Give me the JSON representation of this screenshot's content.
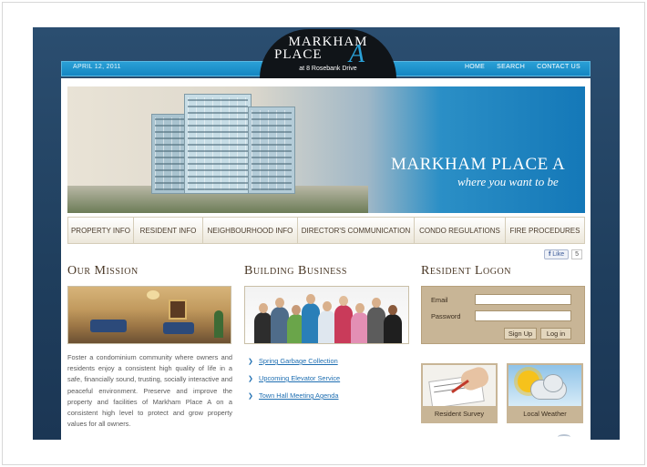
{
  "header": {
    "date": "APRIL 12, 2011",
    "nav": [
      "HOME",
      "SEARCH",
      "CONTACT US"
    ],
    "logo": {
      "line1": "MARKHAM",
      "line2": "PLACE",
      "letter": "A",
      "address": "at 8 Rosebank Drive"
    }
  },
  "hero": {
    "title": "MARKHAM PLACE A",
    "tagline": "where you want to be"
  },
  "mainnav": [
    "PROPERTY INFO",
    "RESIDENT INFO",
    "NEIGHBOURHOOD INFO",
    "DIRECTOR'S COMMUNICATION",
    "CONDO REGULATIONS",
    "FIRE PROCEDURES"
  ],
  "facebook": {
    "like_label": "Like",
    "count": "5"
  },
  "mission": {
    "title": "Our Mission",
    "text": "Foster a condominium community where owners and residents enjoy a consistent high quality of life in a safe, financially sound, trusting, socially interactive and peaceful environment. Preserve and improve the property and facilities of Markham Place A on a consistent high level to protect and grow property values for all owners."
  },
  "business": {
    "title": "Building Business",
    "links": [
      "Spring Garbage Collection",
      "Upcoming Elevator Service",
      "Town Hall Meeting Agenda"
    ]
  },
  "logon": {
    "title": "Resident Logon",
    "email_label": "Email",
    "password_label": "Password",
    "signup": "Sign Up",
    "login": "Log in"
  },
  "tiles": {
    "survey": "Resident Survey",
    "weather": "Local Weather"
  },
  "colors": {
    "accent_blue": "#1486c2",
    "tan": "#c8b596",
    "link_blue": "#1f6fb2"
  }
}
